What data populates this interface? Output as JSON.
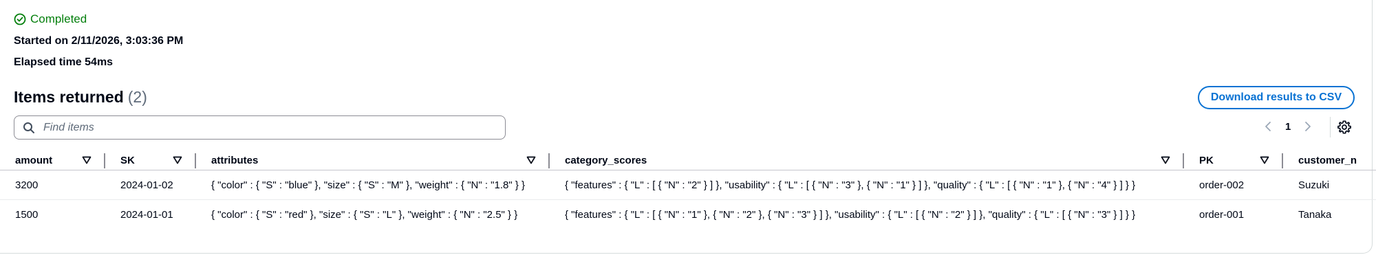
{
  "status": {
    "icon": "check-circle-icon",
    "label": "Completed",
    "color": "#037f0c"
  },
  "started": "Started on 2/11/2026, 3:03:36 PM",
  "elapsed": "Elapsed time 54ms",
  "items": {
    "title": "Items returned",
    "count": "(2)"
  },
  "download_button": "Download results to CSV",
  "search": {
    "placeholder": "Find items",
    "value": ""
  },
  "pagination": {
    "current_page": "1"
  },
  "table": {
    "columns": [
      "amount",
      "SK",
      "attributes",
      "category_scores",
      "PK",
      "customer_n"
    ],
    "rows": [
      {
        "amount": "3200",
        "SK": "2024-01-02",
        "attributes": "{ \"color\" : { \"S\" : \"blue\" }, \"size\" : { \"S\" : \"M\" }, \"weight\" : { \"N\" : \"1.8\" } }",
        "category_scores": "{ \"features\" : { \"L\" : [ { \"N\" : \"2\" } ] }, \"usability\" : { \"L\" : [ { \"N\" : \"3\" }, { \"N\" : \"1\" } ] }, \"quality\" : { \"L\" : [ { \"N\" : \"1\" }, { \"N\" : \"4\" } ] } }",
        "PK": "order-002",
        "customer_name": "Suzuki"
      },
      {
        "amount": "1500",
        "SK": "2024-01-01",
        "attributes": "{ \"color\" : { \"S\" : \"red\" }, \"size\" : { \"S\" : \"L\" }, \"weight\" : { \"N\" : \"2.5\" } }",
        "category_scores": "{ \"features\" : { \"L\" : [ { \"N\" : \"1\" }, { \"N\" : \"2\" }, { \"N\" : \"3\" } ] }, \"usability\" : { \"L\" : [ { \"N\" : \"2\" } ] }, \"quality\" : { \"L\" : [ { \"N\" : \"3\" } ] } }",
        "PK": "order-001",
        "customer_name": "Tanaka"
      }
    ]
  },
  "colors": {
    "accent": "#0972d3",
    "success": "#037f0c",
    "text": "#000716",
    "muted": "#5f6b7a"
  }
}
